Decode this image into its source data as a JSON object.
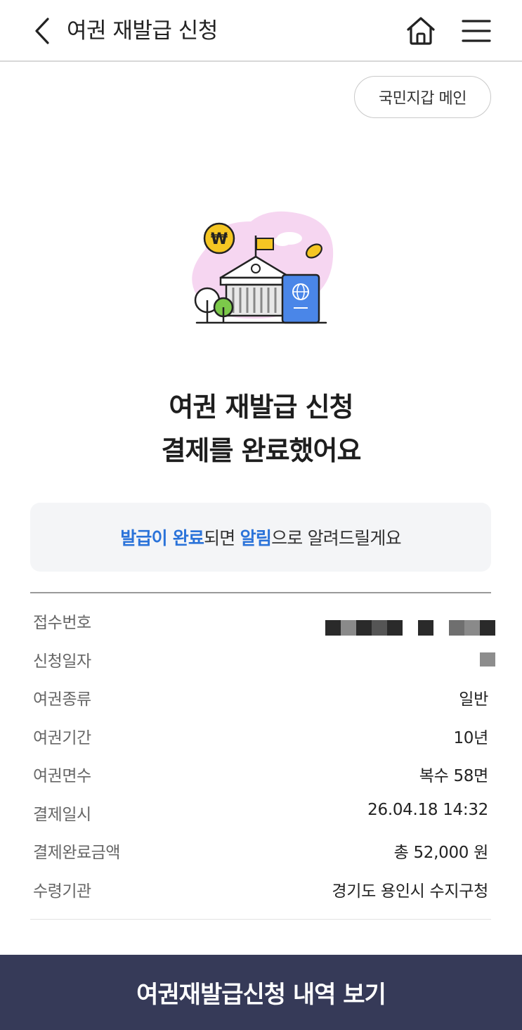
{
  "header": {
    "title": "여권 재발급 신청"
  },
  "wallet_button": {
    "label": "국민지갑 메인"
  },
  "headline": {
    "line1": "여권 재발급 신청",
    "line2": "결제를 완료했어요"
  },
  "notice": {
    "part1": "발급이 완료",
    "part2": "되면 ",
    "part3": "알림",
    "part4": "으로 알려드릴게요"
  },
  "details": {
    "receipt_no": {
      "label": "접수번호",
      "value": ""
    },
    "apply_date": {
      "label": "신청일자",
      "value": ""
    },
    "passport_type": {
      "label": "여권종류",
      "value": "일반"
    },
    "passport_period": {
      "label": "여권기간",
      "value": "10년"
    },
    "passport_pages": {
      "label": "여권면수",
      "value": "복수 58면"
    },
    "payment_datetime": {
      "label": "결제일시",
      "value": "26.04.18 14:32"
    },
    "payment_amount": {
      "label": "결제완료금액",
      "value": "총 52,000 원"
    },
    "pickup_office": {
      "label": "수령기관",
      "value": "경기도 용인시 수지구청"
    }
  },
  "bottom_button": {
    "label": "여권재발급신청 내역 보기"
  },
  "colors": {
    "accent_blue": "#2b73d9",
    "bottom_bar": "#363a58",
    "notice_bg": "#f4f5f7"
  },
  "icons": {
    "back": "chevron-left-icon",
    "home": "home-icon",
    "menu": "hamburger-menu-icon"
  }
}
